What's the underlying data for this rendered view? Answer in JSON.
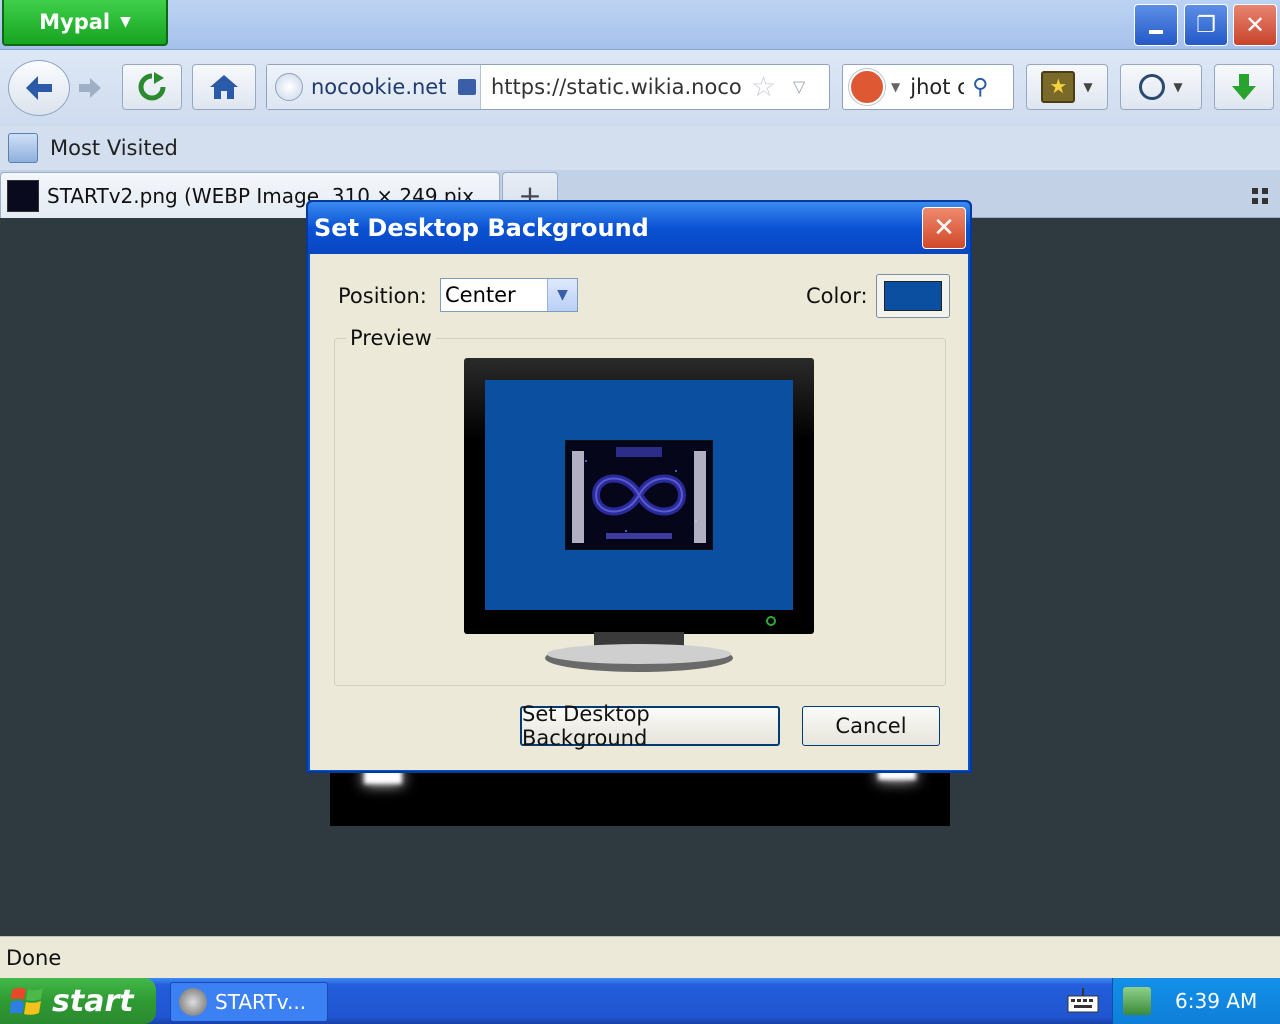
{
  "window": {
    "app_menu_label": "Mypal"
  },
  "navbar": {
    "identity_label": "nocookie.net",
    "url": "https://static.wikia.nocookie",
    "search_value": "jhot c"
  },
  "bookmarks": {
    "most_visited_label": "Most Visited"
  },
  "tabs": [
    {
      "label": "STARTv2.png (WEBP Image, 310 × 249 pix"
    }
  ],
  "dialog": {
    "title": "Set Desktop Background",
    "position_label": "Position:",
    "position_value": "Center",
    "color_label": "Color:",
    "color_value": "#0b4fa0",
    "preview_label": "Preview",
    "set_button": "Set Desktop Background",
    "cancel_button": "Cancel"
  },
  "status": {
    "text": "Done"
  },
  "taskbar": {
    "start_label": "start",
    "task_label": "STARTv...",
    "clock": "6:39 AM"
  },
  "colors": {
    "accent_blue": "#0a52c8",
    "taskbar_blue": "#245edb",
    "start_green": "#3a9d3e"
  }
}
